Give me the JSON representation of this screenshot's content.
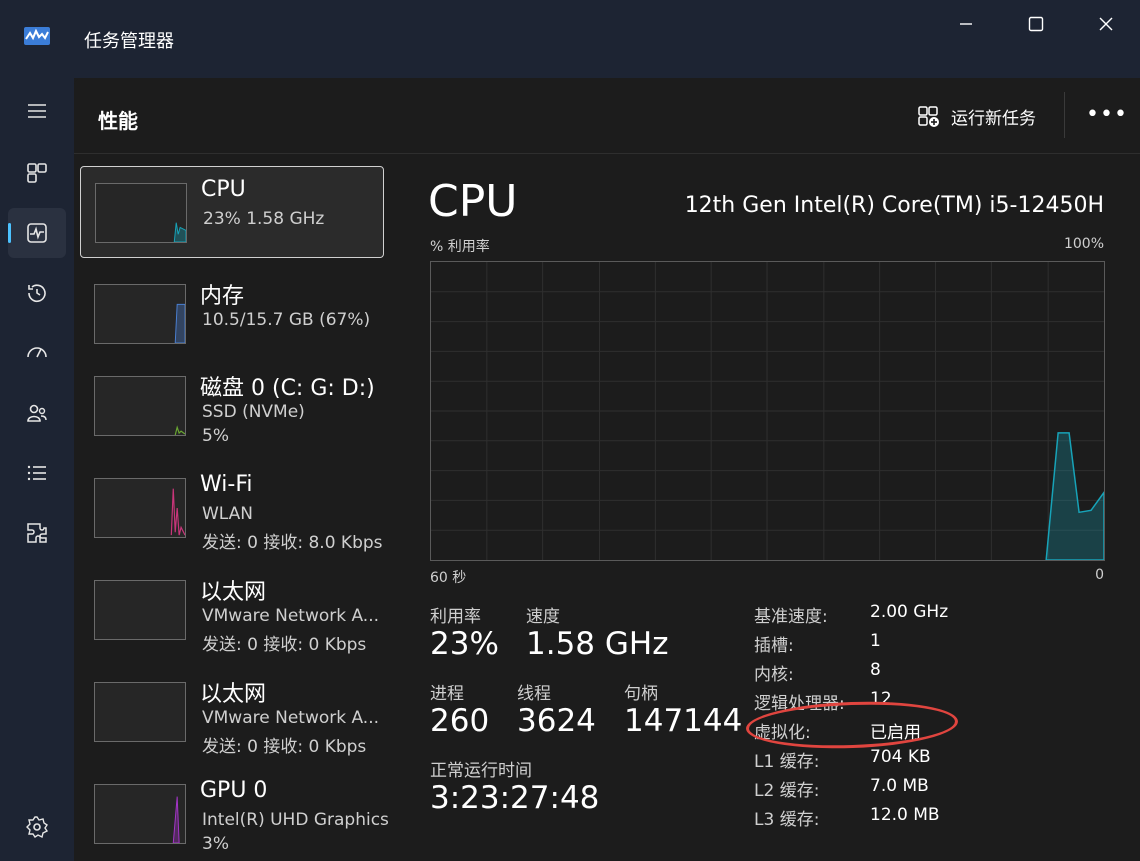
{
  "window": {
    "title": "任务管理器",
    "icon": "task-manager-icon",
    "controls": [
      "minimize-icon",
      "maximize-icon",
      "close-icon"
    ]
  },
  "nav": {
    "items": [
      {
        "icon": "hamburger-menu-icon"
      },
      {
        "icon": "processes-icon"
      },
      {
        "icon": "performance-icon",
        "active": true
      },
      {
        "icon": "app-history-icon"
      },
      {
        "icon": "startup-apps-icon"
      },
      {
        "icon": "users-icon"
      },
      {
        "icon": "details-icon"
      },
      {
        "icon": "services-icon"
      },
      {
        "icon": "settings-icon"
      }
    ]
  },
  "header": {
    "title": "性能",
    "run_task_label": "运行新任务",
    "more_label": "•••"
  },
  "devices": [
    {
      "name": "CPU",
      "line1": "23%  1.58 GHz",
      "line2": "",
      "selected": true,
      "color": "#17a3b8"
    },
    {
      "name": "内存",
      "line1": "10.5/15.7 GB (67%)",
      "line2": "",
      "selected": false,
      "color": "#4a7fd1"
    },
    {
      "name": "磁盘 0 (C: G: D:)",
      "line1": "SSD (NVMe)",
      "line2": "5%",
      "selected": false,
      "color": "#6aa832"
    },
    {
      "name": "Wi-Fi",
      "line1": "WLAN",
      "line2": "发送: 0 接收: 8.0 Kbps",
      "selected": false,
      "color": "#c9357a"
    },
    {
      "name": "以太网",
      "line1": "VMware Network A...",
      "line2": "发送: 0 接收: 0 Kbps",
      "selected": false,
      "color": "#c9357a"
    },
    {
      "name": "以太网",
      "line1": "VMware Network A...",
      "line2": "发送: 0 接收: 0 Kbps",
      "selected": false,
      "color": "#c9357a"
    },
    {
      "name": "GPU 0",
      "line1": "Intel(R) UHD Graphics",
      "line2": "3%",
      "selected": false,
      "color": "#a535c9"
    }
  ],
  "detail": {
    "title": "CPU",
    "model": "12th Gen Intel(R) Core(TM) i5-12450H",
    "graph_label": "% 利用率",
    "graph_max": "100%",
    "axis_left": "60 秒",
    "axis_right": "0",
    "stats": {
      "utilization_label": "利用率",
      "utilization": "23%",
      "speed_label": "速度",
      "speed": "1.58 GHz",
      "processes_label": "进程",
      "processes": "260",
      "threads_label": "线程",
      "threads": "3624",
      "handles_label": "句柄",
      "handles": "147144",
      "uptime_label": "正常运行时间",
      "uptime": "3:23:27:48"
    },
    "specs": [
      {
        "label": "基准速度:",
        "value": "2.00 GHz"
      },
      {
        "label": "插槽:",
        "value": "1"
      },
      {
        "label": "内核:",
        "value": "8"
      },
      {
        "label": "逻辑处理器:",
        "value": "12"
      },
      {
        "label": "虚拟化:",
        "value": "已启用"
      },
      {
        "label": "L1 缓存:",
        "value": "704 KB"
      },
      {
        "label": "L2 缓存:",
        "value": "7.0 MB"
      },
      {
        "label": "L3 缓存:",
        "value": "12.0 MB"
      }
    ],
    "highlight_color": "#e0453f"
  }
}
